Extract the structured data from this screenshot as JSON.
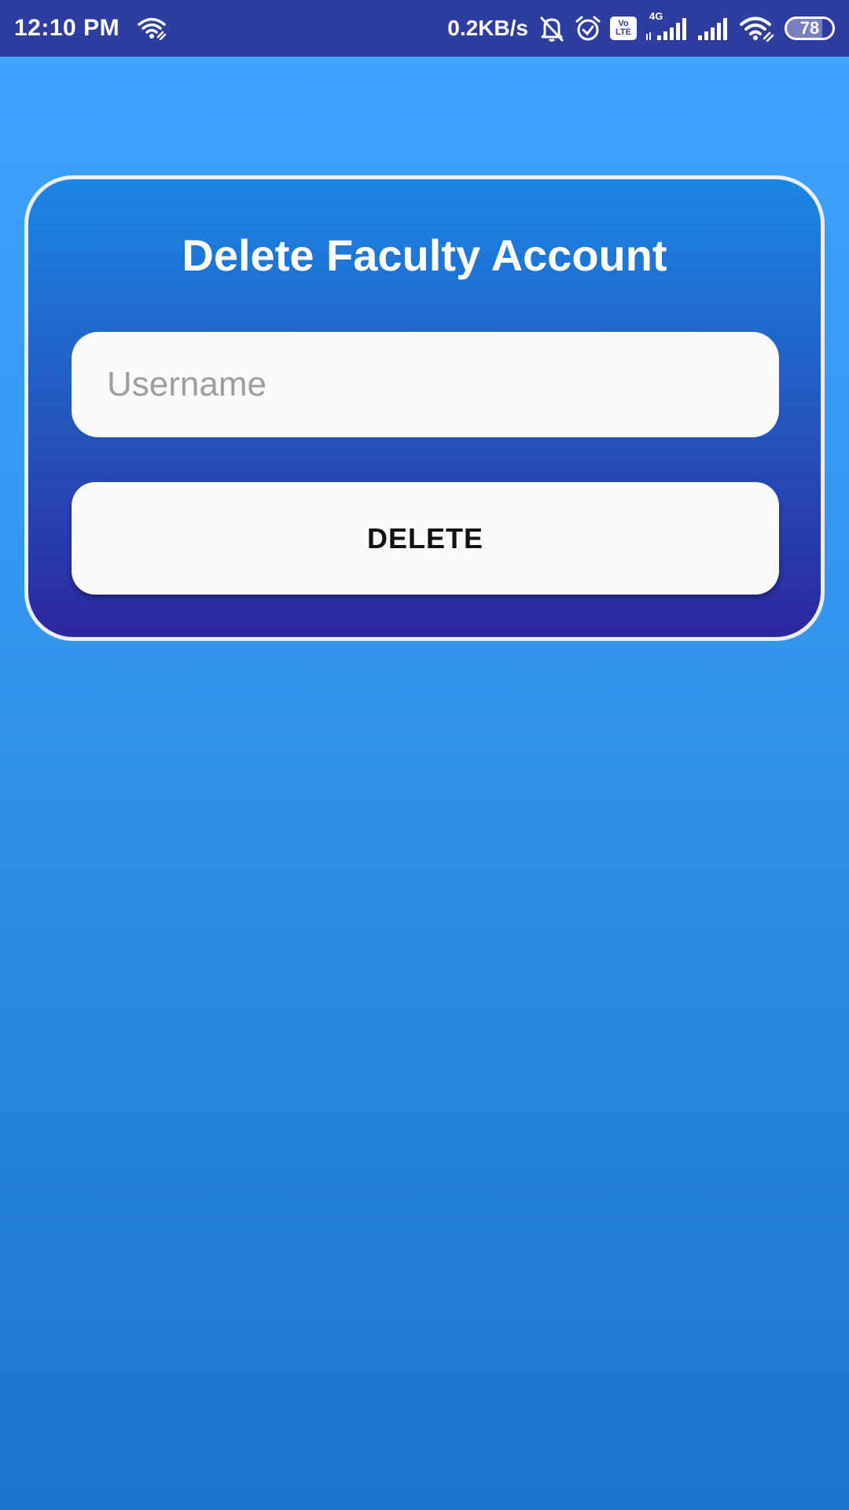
{
  "status_bar": {
    "time": "12:10 PM",
    "net_speed": "0.2KB/s",
    "volte_top": "Vo",
    "volte_bottom": "LTE",
    "network_type": "4G",
    "battery_level": "78",
    "battery_fraction": 0.78,
    "icons": [
      "wifi-link-icon",
      "bell-off-icon",
      "alarm-icon",
      "volte-icon",
      "signal-4g-icon",
      "signal-icon",
      "wifi-link-icon",
      "battery-icon"
    ]
  },
  "form": {
    "title": "Delete Faculty Account",
    "username_placeholder": "Username",
    "username_value": "",
    "delete_label": "DELETE"
  },
  "colors": {
    "status_bar": "#2e3da0",
    "background_top": "#40a3ff",
    "background_bottom": "#1a74cc",
    "card_top": "#1b87e3",
    "card_bottom": "#2c279d",
    "card_border": "#e9eef8",
    "field_bg": "#fafafa"
  }
}
